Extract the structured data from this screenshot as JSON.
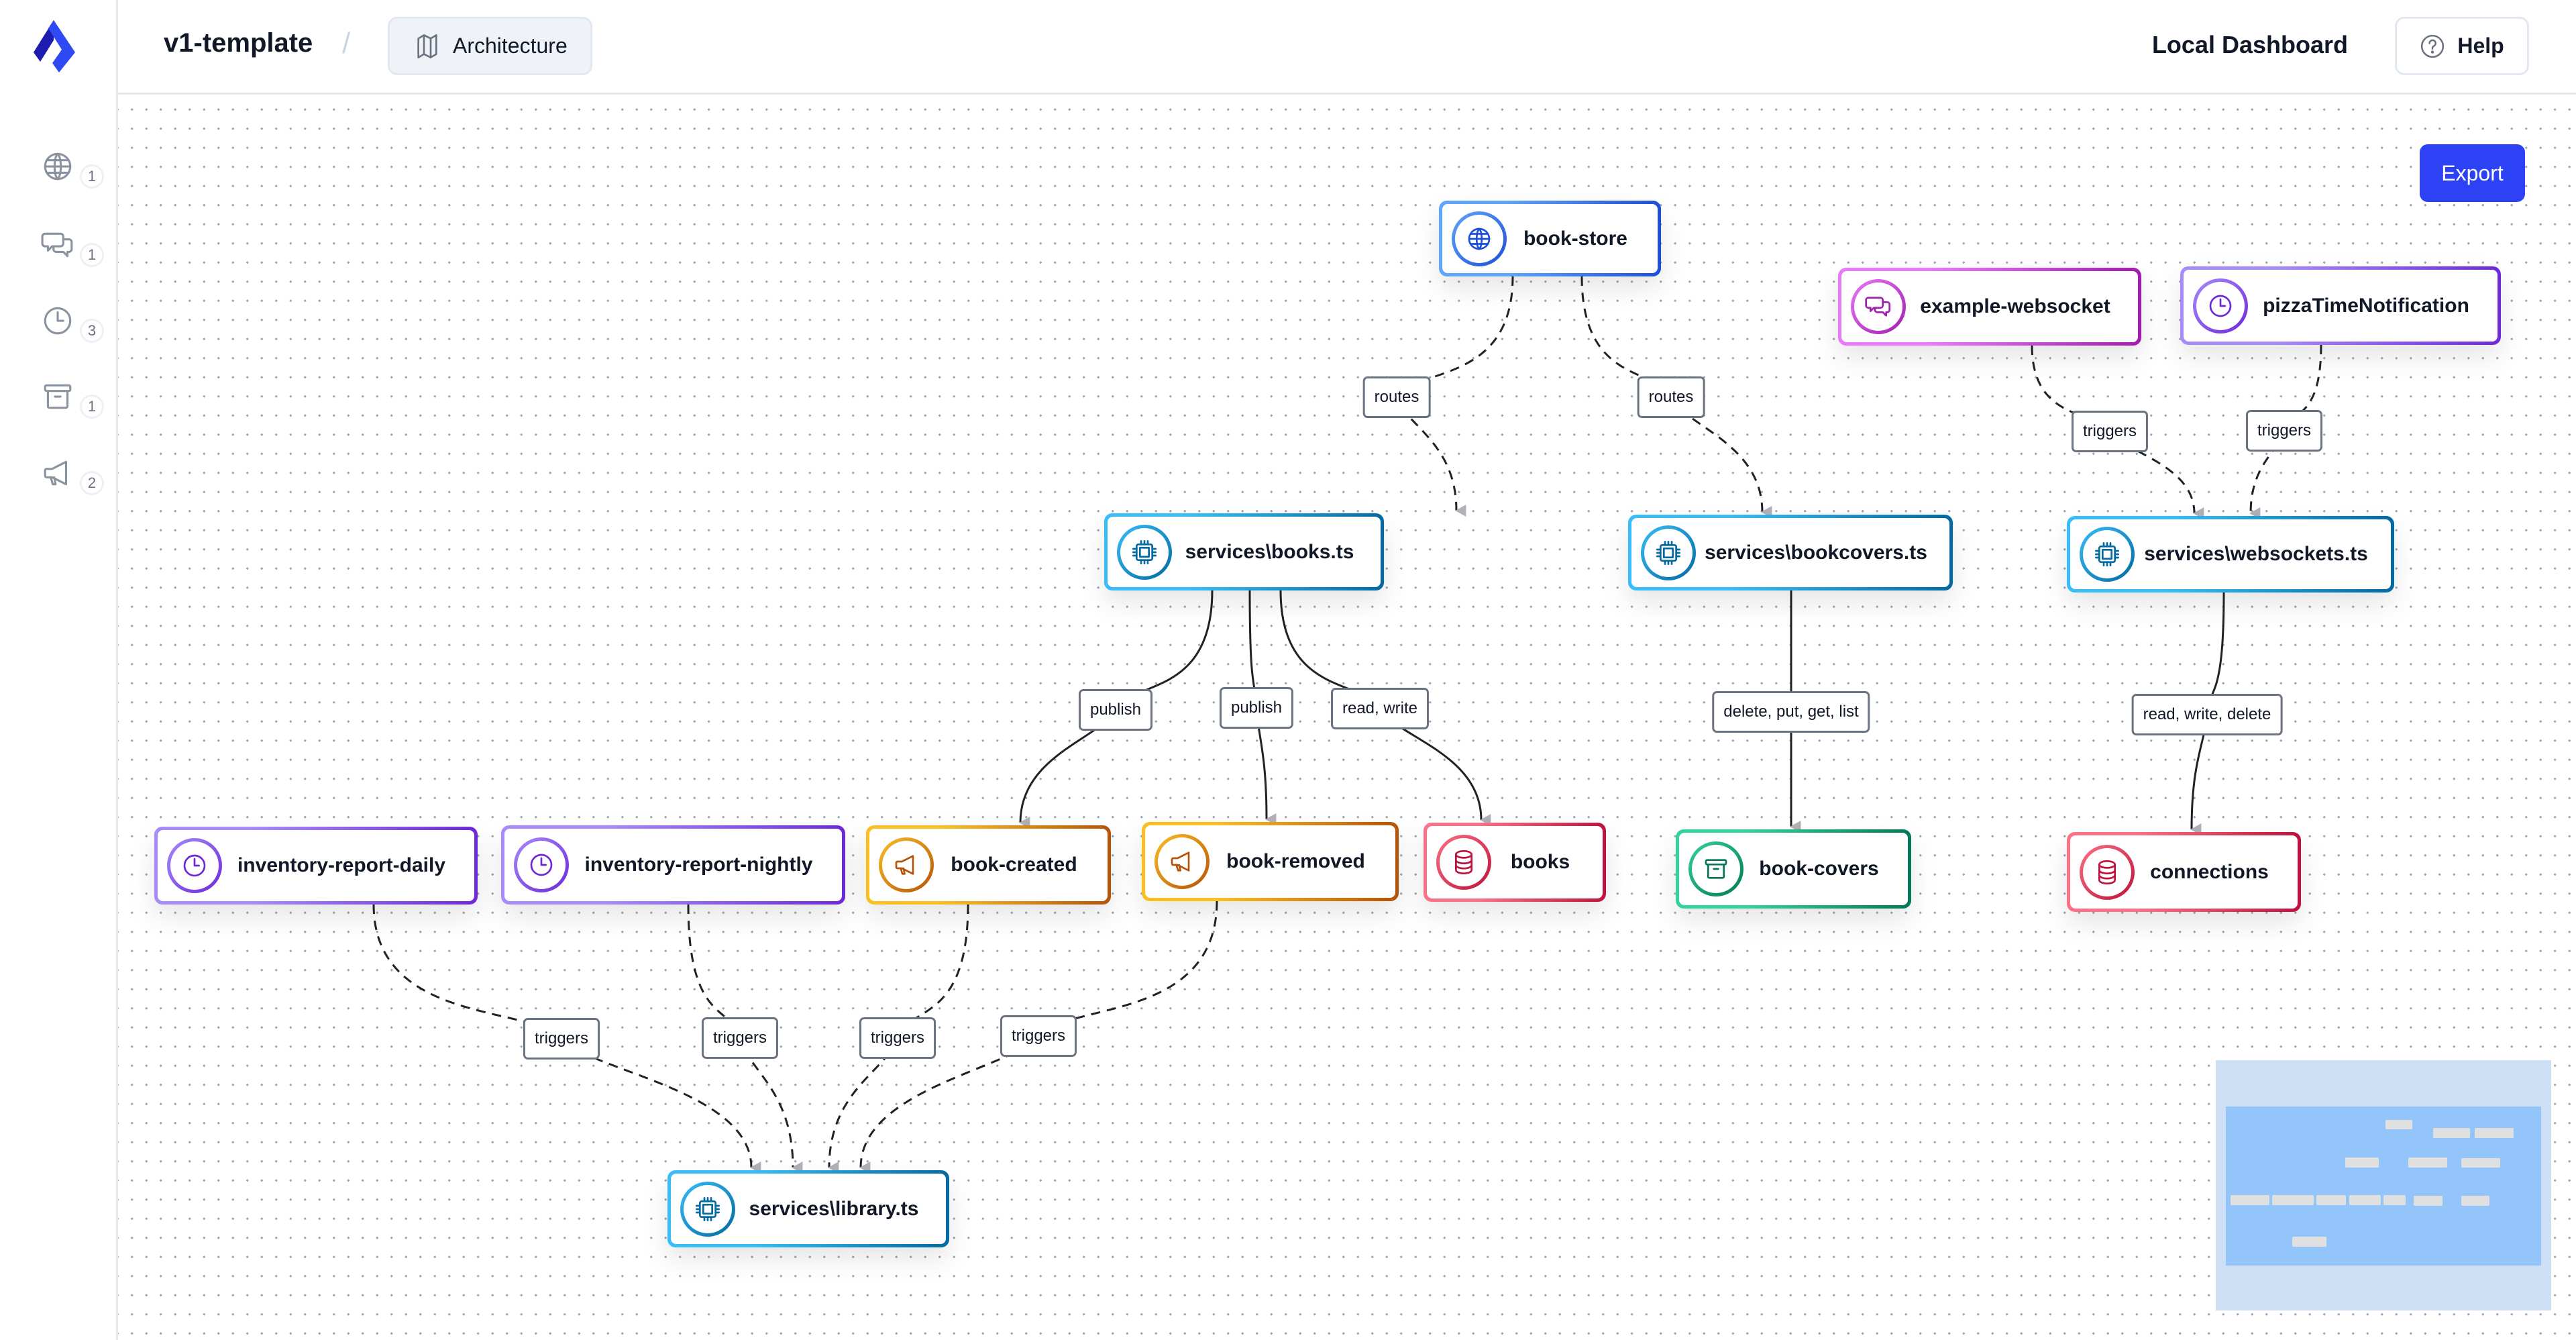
{
  "app": {
    "project_name": "v1-template",
    "breadcrumb_separator": "/",
    "breadcrumb_current": "Architecture",
    "local_dashboard": "Local Dashboard",
    "help_label": "Help",
    "export_label": "Export"
  },
  "sidebar": {
    "items": [
      {
        "icon": "globe-icon",
        "name": "APIs",
        "count": "1"
      },
      {
        "icon": "chat-icon",
        "name": "Websockets",
        "count": "1"
      },
      {
        "icon": "clock-icon",
        "name": "Schedules",
        "count": "3"
      },
      {
        "icon": "archive-icon",
        "name": "Buckets",
        "count": "1"
      },
      {
        "icon": "megaphone-icon",
        "name": "Topics",
        "count": "2"
      }
    ]
  },
  "colors": {
    "api": [
      "#60a5fa",
      "#1d4ed8"
    ],
    "service": [
      "#38bdf8",
      "#0369a1"
    ],
    "websocket": [
      "#e879f9",
      "#a21caf"
    ],
    "schedule": [
      "#a78bfa",
      "#6d28d9"
    ],
    "topic": [
      "#fbbf24",
      "#b45309"
    ],
    "kv": [
      "#fb7185",
      "#be123c"
    ],
    "bucket": [
      "#34d399",
      "#047857"
    ],
    "accent": "#2d42f5"
  },
  "nodes": [
    {
      "id": "book-store",
      "label": "book-store",
      "type": "api",
      "icon": "globe"
    },
    {
      "id": "example-websocket",
      "label": "example-websocket",
      "type": "websocket",
      "icon": "chat"
    },
    {
      "id": "pizzaTimeNotification",
      "label": "pizzaTimeNotification",
      "type": "schedule",
      "icon": "clock"
    },
    {
      "id": "books-svc",
      "label": "services\\books.ts",
      "type": "service",
      "icon": "chip"
    },
    {
      "id": "bookcovers-svc",
      "label": "services\\bookcovers.ts",
      "type": "service",
      "icon": "chip"
    },
    {
      "id": "websockets-svc",
      "label": "services\\websockets.ts",
      "type": "service",
      "icon": "chip"
    },
    {
      "id": "inventory-report-daily",
      "label": "inventory-report-daily",
      "type": "schedule",
      "icon": "clock"
    },
    {
      "id": "inventory-report-nightly",
      "label": "inventory-report-nightly",
      "type": "schedule",
      "icon": "clock"
    },
    {
      "id": "book-created",
      "label": "book-created",
      "type": "topic",
      "icon": "megaphone"
    },
    {
      "id": "book-removed",
      "label": "book-removed",
      "type": "topic",
      "icon": "megaphone"
    },
    {
      "id": "books",
      "label": "books",
      "type": "kv",
      "icon": "database"
    },
    {
      "id": "book-covers",
      "label": "book-covers",
      "type": "bucket",
      "icon": "archive"
    },
    {
      "id": "connections",
      "label": "connections",
      "type": "kv",
      "icon": "database"
    },
    {
      "id": "library-svc",
      "label": "services\\library.ts",
      "type": "service",
      "icon": "chip"
    }
  ],
  "edges": [
    {
      "from": "book-store",
      "to": "books-svc",
      "label": "routes",
      "dashed": true
    },
    {
      "from": "book-store",
      "to": "bookcovers-svc",
      "label": "routes",
      "dashed": true
    },
    {
      "from": "example-websocket",
      "to": "websockets-svc",
      "label": "triggers",
      "dashed": true
    },
    {
      "from": "pizzaTimeNotification",
      "to": "websockets-svc",
      "label": "triggers",
      "dashed": true
    },
    {
      "from": "books-svc",
      "to": "book-created",
      "label": "publish",
      "dashed": false
    },
    {
      "from": "books-svc",
      "to": "book-removed",
      "label": "publish",
      "dashed": false
    },
    {
      "from": "books-svc",
      "to": "books",
      "label": "read, write",
      "dashed": false
    },
    {
      "from": "bookcovers-svc",
      "to": "book-covers",
      "label": "delete, put, get, list",
      "dashed": false
    },
    {
      "from": "websockets-svc",
      "to": "connections",
      "label": "read, write, delete",
      "dashed": false
    },
    {
      "from": "inventory-report-daily",
      "to": "library-svc",
      "label": "triggers",
      "dashed": true
    },
    {
      "from": "inventory-report-nightly",
      "to": "library-svc",
      "label": "triggers",
      "dashed": true
    },
    {
      "from": "book-created",
      "to": "library-svc",
      "label": "triggers",
      "dashed": true
    },
    {
      "from": "book-removed",
      "to": "library-svc",
      "label": "triggers",
      "dashed": true
    }
  ]
}
